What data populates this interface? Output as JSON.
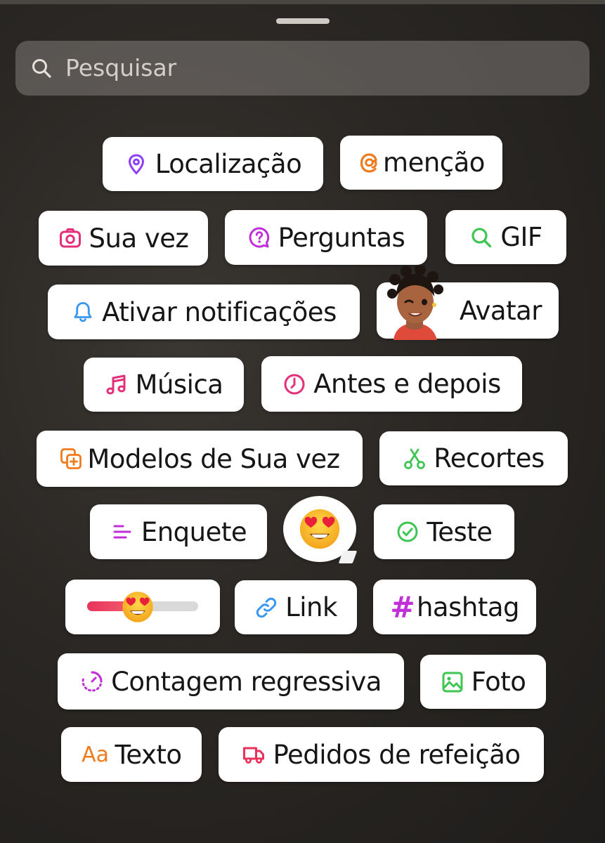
{
  "search": {
    "placeholder": "Pesquisar"
  },
  "stickers": {
    "location": "Localização",
    "mention": "menção",
    "your_turn": "Sua vez",
    "questions": "Perguntas",
    "gif": "GIF",
    "notifications": "Ativar notificações",
    "avatar": "Avatar",
    "music": "Música",
    "before_after": "Antes e depois",
    "templates": "Modelos de Sua vez",
    "cutouts": "Recortes",
    "poll": "Enquete",
    "quiz": "Teste",
    "link": "Link",
    "hashtag": "hashtag",
    "countdown": "Contagem regressiva",
    "photo": "Foto",
    "text": "Texto",
    "food_orders": "Pedidos de refeição"
  },
  "emoji_slider": {
    "value": 0.42
  },
  "icons": {
    "location": "map-pin-icon",
    "mention": "threads-at-icon",
    "your_turn": "camera-icon",
    "questions": "question-bubble-icon",
    "gif": "search-icon",
    "notifications": "bell-icon",
    "avatar": "avatar-icon",
    "music": "music-note-icon",
    "before_after": "clock-icon",
    "templates": "add-template-icon",
    "cutouts": "scissors-icon",
    "poll": "poll-lines-icon",
    "emoji_reaction": "heart-eyes-emoji-icon",
    "quiz": "check-circle-icon",
    "link": "link-icon",
    "hashtag": "hash-icon",
    "countdown": "timer-icon",
    "photo": "image-icon",
    "text": "text-aa-icon",
    "food_orders": "delivery-truck-icon"
  },
  "colors": {
    "purple": "#8a3ffc",
    "orange": "#f07b1f",
    "pink": "#e4307a",
    "magenta": "#c02fd8",
    "green": "#3fc552",
    "blue": "#3897f0",
    "red": "#e8325c"
  }
}
